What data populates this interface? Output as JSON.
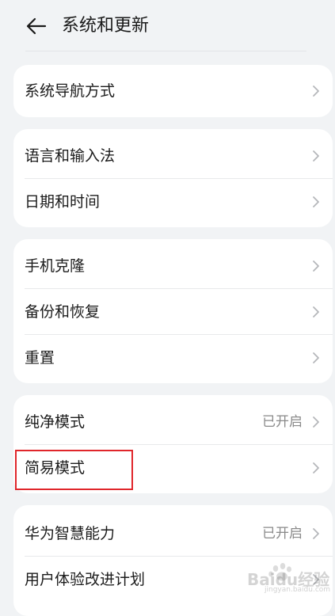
{
  "header": {
    "title": "系统和更新",
    "back_icon": "back-arrow-icon"
  },
  "groups": [
    {
      "items": [
        {
          "label": "系统导航方式",
          "value": ""
        }
      ]
    },
    {
      "items": [
        {
          "label": "语言和输入法",
          "value": ""
        },
        {
          "label": "日期和时间",
          "value": ""
        }
      ]
    },
    {
      "items": [
        {
          "label": "手机克隆",
          "value": ""
        },
        {
          "label": "备份和恢复",
          "value": ""
        },
        {
          "label": "重置",
          "value": ""
        }
      ]
    },
    {
      "items": [
        {
          "label": "纯净模式",
          "value": "已开启"
        },
        {
          "label": "简易模式",
          "value": ""
        }
      ]
    },
    {
      "items": [
        {
          "label": "华为智慧能力",
          "value": "已开启"
        },
        {
          "label": "用户体验改进计划",
          "value": ""
        }
      ]
    }
  ],
  "highlight": {
    "color": "#e0262b"
  },
  "watermark": {
    "text": "Baidu经验",
    "url": "jingyan.baidu.com"
  },
  "colors": {
    "background": "#f1f3f5",
    "card": "#ffffff",
    "secondary_text": "#8a8a8a",
    "chevron": "#b5b7ba"
  }
}
